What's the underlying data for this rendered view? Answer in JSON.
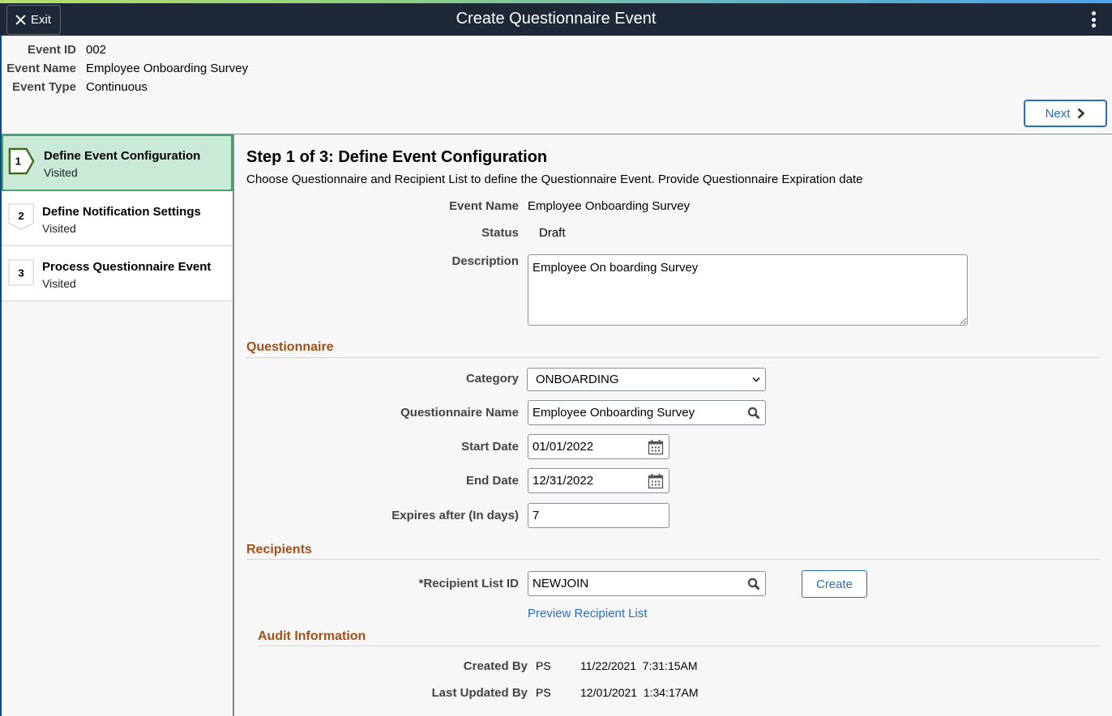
{
  "banner": {
    "exit_label": "Exit",
    "title": "Create Questionnaire Event",
    "menu_icon": "kebab-vertical-icon"
  },
  "header_info": [
    {
      "label": "Event ID",
      "value": "002"
    },
    {
      "label": "Event Name",
      "value": "Employee Onboarding Survey"
    },
    {
      "label": "Event Type",
      "value": "Continuous"
    }
  ],
  "navigation": {
    "next_label": "Next"
  },
  "steps": [
    {
      "number": "1",
      "title": "Define Event Configuration",
      "status": "Visited",
      "active": true
    },
    {
      "number": "2",
      "title": "Define Notification Settings",
      "status": "Visited",
      "active": false
    },
    {
      "number": "3",
      "title": "Process Questionnaire Event",
      "status": "Visited",
      "active": false
    }
  ],
  "main": {
    "title": "Step 1 of 3: Define Event Configuration",
    "description": "Choose Questionnaire and Recipient List to define the Questionnaire Event. Provide Questionnaire Expiration date",
    "event_name": {
      "label": "Event Name",
      "value": "Employee Onboarding Survey"
    },
    "status": {
      "label": "Status",
      "value": "Draft"
    },
    "description_field": {
      "label": "Description",
      "value": "Employee On boarding Survey"
    }
  },
  "questionnaire": {
    "heading": "Questionnaire",
    "category": {
      "label": "Category",
      "value": "ONBOARDING"
    },
    "questionnaire_name": {
      "label": "Questionnaire Name",
      "value": "Employee Onboarding Survey"
    },
    "start_date": {
      "label": "Start Date",
      "value": "01/01/2022"
    },
    "end_date": {
      "label": "End Date",
      "value": "12/31/2022"
    },
    "expires_after": {
      "label": "Expires after (In days)",
      "value": "7"
    }
  },
  "recipients": {
    "heading": "Recipients",
    "recipient_list_id": {
      "label": "*Recipient List ID",
      "value": "NEWJOIN"
    },
    "create_label": "Create",
    "preview_link": "Preview Recipient List"
  },
  "audit": {
    "heading": "Audit Information",
    "created_by": {
      "label": "Created By",
      "user": "PS",
      "datetime": "11/22/2021  7:31:15AM"
    },
    "last_updated_by": {
      "label": "Last Updated By",
      "user": "PS",
      "datetime": "12/01/2021  1:34:17AM"
    }
  },
  "colors": {
    "banner": "#1e2836",
    "accent_link": "#2a6ebb",
    "section_heading": "#a0501a",
    "active_step_bg": "#c9ead6",
    "active_step_border": "#46a36c"
  }
}
